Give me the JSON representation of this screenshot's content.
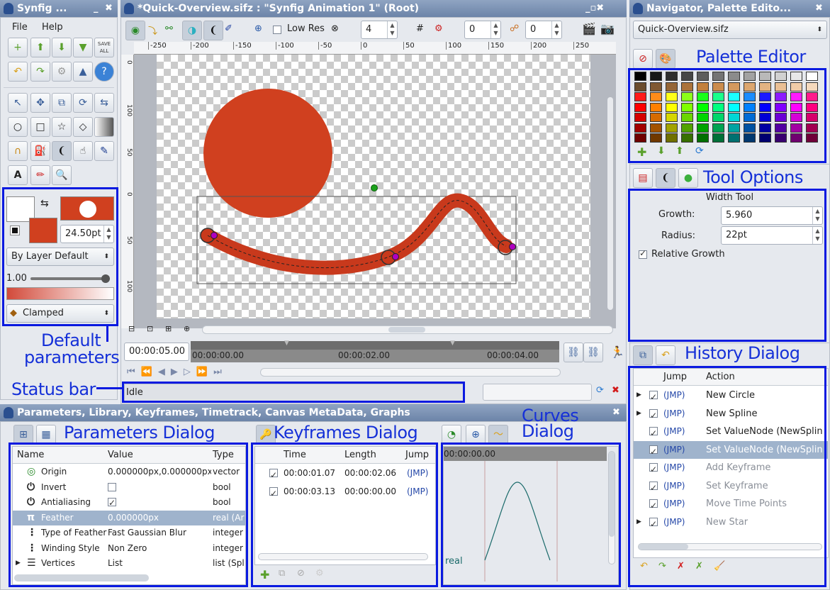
{
  "toolbox": {
    "title": "Synfig ...",
    "menu_file": "File",
    "menu_help": "Help",
    "save_all": "SAVE ALL",
    "width_value": "24.50pt",
    "blend_method": "By Layer Default",
    "opacity": "1.00",
    "interpolation": "Clamped"
  },
  "canvas": {
    "title": "*Quick-Overview.sifz : \"Synfig Animation 1\" (Root)",
    "low_res": "Low Res",
    "quality": "4",
    "start_frame": "0",
    "end_frame": "0",
    "ruler_labels": [
      "-250",
      "-200",
      "-150",
      "-100",
      "-50",
      "0",
      "50",
      "100",
      "150",
      "200",
      "250"
    ],
    "vruler_labels": [
      "0",
      "100",
      "50",
      "0",
      "50",
      "100"
    ],
    "current_time": "00:00:05.00",
    "time_marks": [
      "00:00:00.00",
      "00:00:02.00",
      "00:00:04.00"
    ],
    "status": "Idle"
  },
  "navigator": {
    "title": "Navigator, Palette Edito...",
    "file": "Quick-Overview.sifz"
  },
  "tool_options": {
    "section": "Width Tool",
    "growth_label": "Growth:",
    "growth_value": "5.960",
    "radius_label": "Radius:",
    "radius_value": "22pt",
    "relative_growth": "Relative Growth"
  },
  "history": {
    "col_jump": "Jump",
    "col_action": "Action",
    "rows": [
      {
        "jmp": "(JMP)",
        "action": "New Circle",
        "expander": true,
        "active": true,
        "selected": false
      },
      {
        "jmp": "(JMP)",
        "action": "New Spline",
        "expander": true,
        "active": true,
        "selected": false
      },
      {
        "jmp": "(JMP)",
        "action": "Set ValueNode (NewSplin",
        "expander": false,
        "active": true,
        "selected": false
      },
      {
        "jmp": "(JMP)",
        "action": "Set ValueNode (NewSplin",
        "expander": false,
        "active": true,
        "selected": true
      },
      {
        "jmp": "(JMP)",
        "action": "Add Keyframe",
        "expander": false,
        "active": false,
        "selected": false
      },
      {
        "jmp": "(JMP)",
        "action": "Set Keyframe",
        "expander": false,
        "active": false,
        "selected": false
      },
      {
        "jmp": "(JMP)",
        "action": "Move Time Points",
        "expander": false,
        "active": false,
        "selected": false
      },
      {
        "jmp": "(JMP)",
        "action": "New Star",
        "expander": true,
        "active": false,
        "selected": false
      }
    ]
  },
  "params_panel": {
    "title": "Parameters, Library, Keyframes, Timetrack, Canvas MetaData, Graphs",
    "col_name": "Name",
    "col_value": "Value",
    "col_type": "Type",
    "rows": [
      {
        "icon": "◎",
        "name": "Origin",
        "value": "0.000000px,0.000000px",
        "type": "vector"
      },
      {
        "icon": "⏻",
        "name": "Invert",
        "value": "",
        "type": "bool"
      },
      {
        "icon": "⏻",
        "name": "Antialiasing",
        "value": "✓",
        "type": "bool"
      },
      {
        "icon": "π",
        "name": "Feather",
        "value": "0.000000px",
        "type": "real (Ar"
      },
      {
        "icon": "⋮",
        "name": "Type of Feather",
        "value": "Fast Gaussian Blur",
        "type": "integer"
      },
      {
        "icon": "⋮",
        "name": "Winding Style",
        "value": "Non Zero",
        "type": "integer"
      },
      {
        "icon": "☰",
        "name": "Vertices",
        "value": "List",
        "type": "list (Spl"
      }
    ]
  },
  "keyframes": {
    "col_time": "Time",
    "col_length": "Length",
    "col_jump": "Jump",
    "rows": [
      {
        "time": "00:00:01.07",
        "length": "00:00:02.06",
        "jump": "(JMP)"
      },
      {
        "time": "00:00:03.13",
        "length": "00:00:00.00",
        "jump": "(JMP)"
      }
    ]
  },
  "curves": {
    "time": "00:00:00.00",
    "label": "real"
  },
  "annotations": {
    "palette_editor": "Palette Editor",
    "tool_options": "Tool Options",
    "history_dialog": "History Dialog",
    "default_parameters_1": "Default",
    "default_parameters_2": "parameters",
    "status_bar": "Status bar",
    "parameters_dialog": "Parameters Dialog",
    "keyframes_dialog": "Keyframes Dialog",
    "curves_dialog_1": "Curves",
    "curves_dialog_2": "Dialog"
  },
  "colors": {
    "accent": "#0a1ae0",
    "shape": "#d0401f",
    "titlebar": "#7389ab",
    "selection": "#9fb3cc"
  }
}
